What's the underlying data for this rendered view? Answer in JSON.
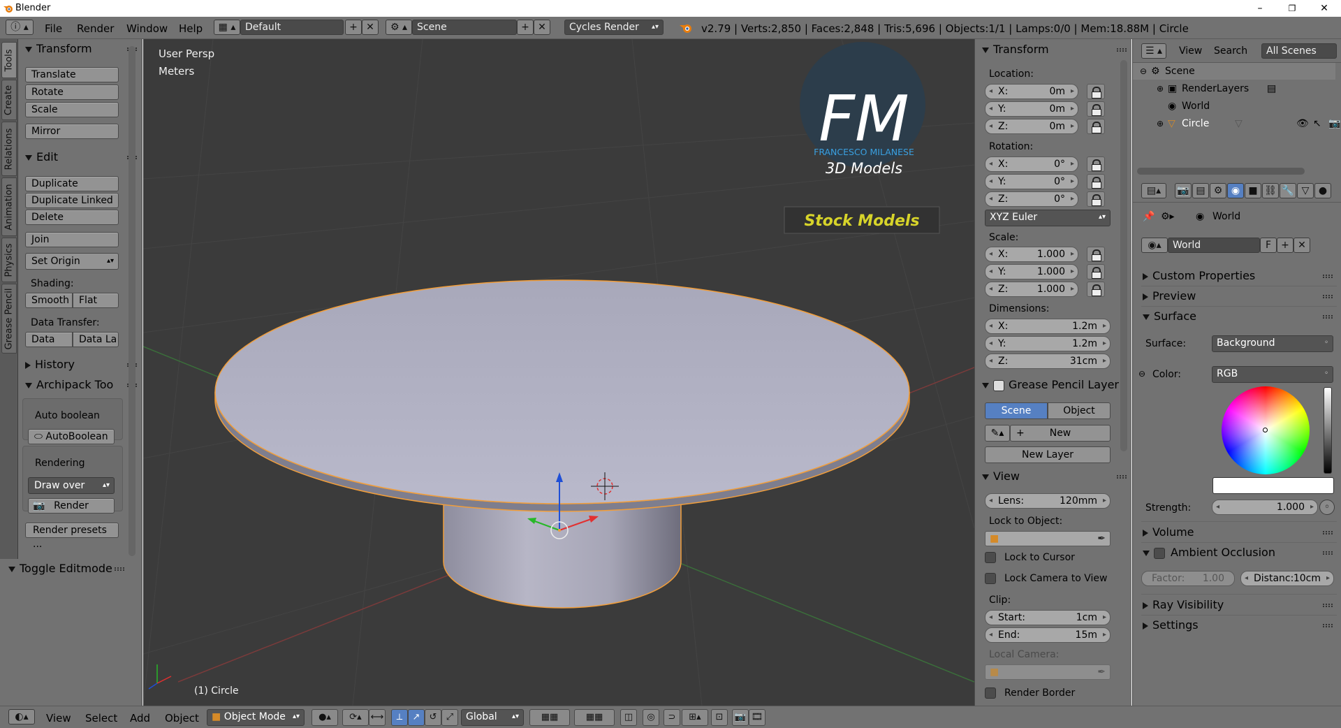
{
  "window": {
    "title": "Blender",
    "minimize": "–",
    "maximize": "❐",
    "close": "✕"
  },
  "infobar": {
    "menus": [
      "File",
      "Render",
      "Window",
      "Help"
    ],
    "layout": "Default",
    "scene": "Scene",
    "engine": "Cycles Render",
    "stats": "v2.79 | Verts:2,850 | Faces:2,848 | Tris:5,696 | Objects:1/1 | Lamps:0/0 | Mem:18.88M | Circle"
  },
  "tabs": [
    "Tools",
    "Create",
    "Relations",
    "Animation",
    "Physics",
    "Grease Pencil"
  ],
  "toolshelf": {
    "transform_title": "Transform",
    "translate": "Translate",
    "rotate": "Rotate",
    "scale": "Scale",
    "mirror": "Mirror",
    "edit_title": "Edit",
    "duplicate": "Duplicate",
    "duplicate_linked": "Duplicate Linked",
    "delete": "Delete",
    "join": "Join",
    "set_origin": "Set Origin",
    "shading_label": "Shading:",
    "smooth": "Smooth",
    "flat": "Flat",
    "data_transfer_label": "Data Transfer:",
    "data": "Data",
    "data_la": "Data La",
    "history_title": "History",
    "archipack_title": "Archipack Too",
    "auto_boolean_label": "Auto boolean",
    "autoboolean_btn": "AutoBoolean",
    "rendering_label": "Rendering",
    "draw_over": "Draw over",
    "render_btn": "Render",
    "render_presets": "Render presets ...",
    "toggle_editmode": "Toggle Editmode"
  },
  "viewport": {
    "persp": "User Persp",
    "units": "Meters",
    "object_label": "(1) Circle",
    "logo": {
      "letters": "FM",
      "name": "FRANCESCO MILANESE",
      "sub": "3D Models",
      "stock": "Stock Models"
    }
  },
  "npanel": {
    "transform_title": "Transform",
    "location_label": "Location:",
    "loc": [
      {
        "axis": "X:",
        "val": "0m"
      },
      {
        "axis": "Y:",
        "val": "0m"
      },
      {
        "axis": "Z:",
        "val": "0m"
      }
    ],
    "rotation_label": "Rotation:",
    "rot": [
      {
        "axis": "X:",
        "val": "0°"
      },
      {
        "axis": "Y:",
        "val": "0°"
      },
      {
        "axis": "Z:",
        "val": "0°"
      }
    ],
    "rot_mode": "XYZ Euler",
    "scale_label": "Scale:",
    "scl": [
      {
        "axis": "X:",
        "val": "1.000"
      },
      {
        "axis": "Y:",
        "val": "1.000"
      },
      {
        "axis": "Z:",
        "val": "1.000"
      }
    ],
    "dimensions_label": "Dimensions:",
    "dim": [
      {
        "axis": "X:",
        "val": "1.2m"
      },
      {
        "axis": "Y:",
        "val": "1.2m"
      },
      {
        "axis": "Z:",
        "val": "31cm"
      }
    ],
    "gp_title": "Grease Pencil Layer",
    "gp_scene": "Scene",
    "gp_object": "Object",
    "gp_new": "New",
    "gp_new_layer": "New Layer",
    "view_title": "View",
    "lens_label": "Lens:",
    "lens_val": "120mm",
    "lock_to_object": "Lock to Object:",
    "lock_to_cursor": "Lock to Cursor",
    "lock_camera": "Lock Camera to View",
    "clip_label": "Clip:",
    "clip_start_label": "Start:",
    "clip_start": "1cm",
    "clip_end_label": "End:",
    "clip_end": "15m",
    "local_camera": "Local Camera:",
    "render_border": "Render Border"
  },
  "outliner": {
    "view": "View",
    "search": "Search",
    "filter": "All Scenes",
    "rows": [
      "Scene",
      "RenderLayers",
      "World",
      "Circle"
    ]
  },
  "properties": {
    "context": "World",
    "world_name": "World",
    "fake_user": "F",
    "custom_properties": "Custom Properties",
    "preview": "Preview",
    "surface": "Surface",
    "surface_label": "Surface:",
    "surface_val": "Background",
    "color_label": "Color:",
    "color_val": "RGB",
    "strength_label": "Strength:",
    "strength_val": "1.000",
    "volume": "Volume",
    "ambient_occlusion": "Ambient Occlusion",
    "factor_label": "Factor:",
    "factor_val": "1.00",
    "distance_label": "Distanc:",
    "distance_val": "10cm",
    "ray_visibility": "Ray Visibility",
    "settings": "Settings"
  },
  "bottombar": {
    "view": "View",
    "select": "Select",
    "add": "Add",
    "object": "Object",
    "mode": "Object Mode",
    "orientation": "Global"
  },
  "colors": {
    "accent": "#5680c2",
    "logo_blue": "#3aa0e0",
    "stock_yellow": "#d7d42a",
    "selection": "#f29e3a"
  }
}
